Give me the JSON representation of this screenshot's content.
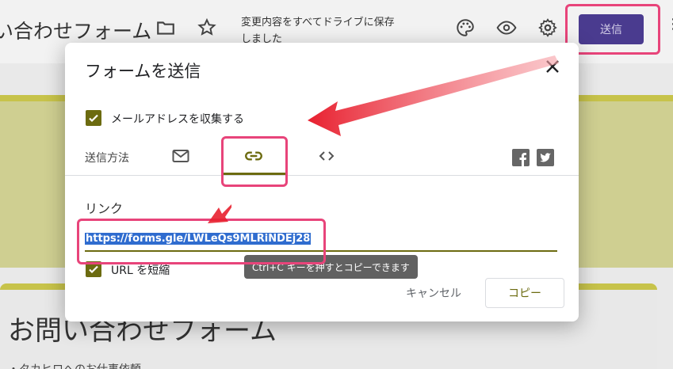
{
  "editor": {
    "form_title": "い合わせフォーム",
    "save_status": "変更内容をすべてドライブに保存しました",
    "send_button": "送信",
    "more_glyph": "⋮",
    "form_heading": "お問い合わせフォーム",
    "form_description": "・タカヒロへのお仕事依頼"
  },
  "dialog": {
    "title": "フォームを送信",
    "collect_email_label": "メールアドレスを収集する",
    "collect_email_checked": true,
    "send_method_label": "送信方法",
    "tabs": [
      {
        "icon": "mail-icon"
      },
      {
        "icon": "link-icon",
        "active": true
      },
      {
        "icon": "embed-icon"
      }
    ],
    "link_section_label": "リンク",
    "link_url": "https://forms.gle/LWLeQs9MLRiNDEj28",
    "shorten_url_label": "URL を短縮",
    "shorten_url_checked": true,
    "tooltip": "Ctrl+C キーを押すとコピーできます",
    "cancel_button": "キャンセル",
    "copy_button": "コピー"
  },
  "colors": {
    "accent": "#6c6b10",
    "send_button": "#4a3b8f",
    "highlight": "#e8447a",
    "arrow": "#e8202f",
    "selection": "#2f6ccf"
  }
}
